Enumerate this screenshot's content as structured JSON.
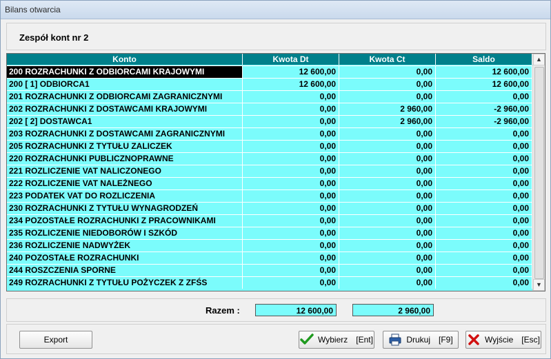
{
  "window": {
    "title": "Bilans otwarcia"
  },
  "header": {
    "title": "Zespół kont nr  2"
  },
  "table": {
    "columns": [
      "Konto",
      "Kwota Dt",
      "Kwota Ct",
      "Saldo"
    ],
    "rows": [
      [
        "200  ROZRACHUNKI Z ODBIORCAMI KRAJOWYMI",
        "12 600,00",
        "0,00",
        "12 600,00"
      ],
      [
        "200 [   1] ODBIORCA1",
        "12 600,00",
        "0,00",
        "12 600,00"
      ],
      [
        "201  ROZRACHUNKI Z ODBIORCAMI ZAGRANICZNYMI",
        "0,00",
        "0,00",
        "0,00"
      ],
      [
        "202  ROZRACHUNKI Z DOSTAWCAMI KRAJOWYMI",
        "0,00",
        "2 960,00",
        "-2 960,00"
      ],
      [
        "202 [   2] DOSTAWCA1",
        "0,00",
        "2 960,00",
        "-2 960,00"
      ],
      [
        "203  ROZRACHUNKI Z DOSTAWCAMI ZAGRANICZNYMI",
        "0,00",
        "0,00",
        "0,00"
      ],
      [
        "205  ROZRACHUNKI Z TYTUŁU ZALICZEK",
        "0,00",
        "0,00",
        "0,00"
      ],
      [
        "220  ROZRACHUNKI PUBLICZNOPRAWNE",
        "0,00",
        "0,00",
        "0,00"
      ],
      [
        "221  ROZLICZENIE VAT NALICZONEGO",
        "0,00",
        "0,00",
        "0,00"
      ],
      [
        "222  ROZLICZENIE VAT NALEŻNEGO",
        "0,00",
        "0,00",
        "0,00"
      ],
      [
        "223  PODATEK VAT DO ROZLICZENIA",
        "0,00",
        "0,00",
        "0,00"
      ],
      [
        "230  ROZRACHUNKI Z TYTUŁU WYNAGRODZEŃ",
        "0,00",
        "0,00",
        "0,00"
      ],
      [
        "234  POZOSTAŁE ROZRACHUNKI Z PRACOWNIKAMI",
        "0,00",
        "0,00",
        "0,00"
      ],
      [
        "235  ROZLICZENIE NIEDOBORÓW I SZKÓD",
        "0,00",
        "0,00",
        "0,00"
      ],
      [
        "236  ROZLICZENIE NADWYŻEK",
        "0,00",
        "0,00",
        "0,00"
      ],
      [
        "240  POZOSTAŁE ROZRACHUNKI",
        "0,00",
        "0,00",
        "0,00"
      ],
      [
        "244  ROSZCZENIA SPORNE",
        "0,00",
        "0,00",
        "0,00"
      ],
      [
        "249  ROZRACHUNKI Z TYTUŁU POŻYCZEK Z ZFŚS",
        "0,00",
        "0,00",
        "0,00"
      ]
    ],
    "selected_row": 0
  },
  "totals": {
    "label": "Razem :",
    "dt": "12 600,00",
    "ct": "2 960,00"
  },
  "buttons": {
    "export": {
      "label": "Export"
    },
    "wybierz": {
      "label": "Wybierz",
      "key": "[Ent]",
      "icon": "checkmark-icon"
    },
    "drukuj": {
      "label": "Drukuj",
      "key": "[F9]",
      "icon": "printer-icon"
    },
    "wyjscie": {
      "label": "Wyjście",
      "key": "[Esc]",
      "icon": "close-icon"
    }
  },
  "colors": {
    "grid_bg": "#7bfcfc",
    "header_bg": "#00808b",
    "selected_bg": "#000000"
  }
}
